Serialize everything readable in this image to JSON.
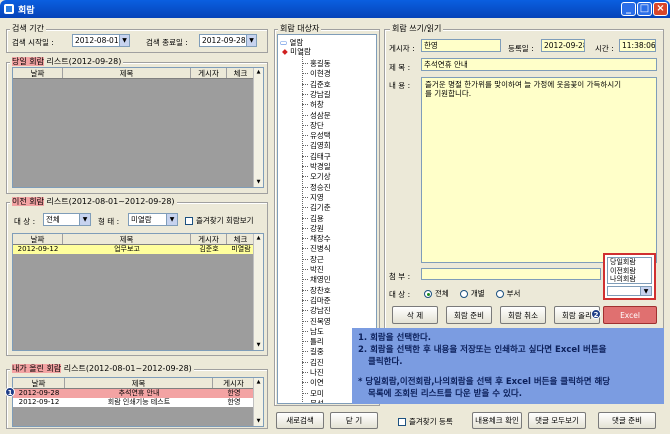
{
  "window": {
    "title": "회람"
  },
  "period": {
    "legend": "검색 기간",
    "start_label": "검색 시작일 :",
    "start_value": "2012-08-01",
    "end_label": "검색 종료일 :",
    "end_value": "2012-09-28"
  },
  "today": {
    "legend_hl": "당일 회람",
    "legend_rest": "리스트(2012-09-28)",
    "columns": [
      "날짜",
      "제목",
      "게시자",
      "체크"
    ]
  },
  "previous": {
    "legend_hl": "이전 회람",
    "legend_rest": "리스트(2012-08-01~2012-09-28)",
    "target_label": "대 상 :",
    "target_value": "전체",
    "type_label": "형 태 :",
    "type_value": "미열람",
    "fav_label": "즐겨찾기 회람보기",
    "columns": [
      "날짜",
      "제목",
      "게시자",
      "체크"
    ],
    "rows": [
      [
        "2012-09-12",
        "업무보고",
        "김준호",
        "미열람"
      ]
    ]
  },
  "mine": {
    "legend_hl": "내가 올린 회람",
    "legend_rest": "리스트(2012-08-01~2012-09-28)",
    "columns": [
      "날짜",
      "제목",
      "게시자"
    ],
    "rows": [
      [
        "2012-09-28",
        "추석연휴 안내",
        "한영"
      ],
      [
        "2012-09-12",
        "회람 인쇄기능 테스트",
        "한영"
      ]
    ]
  },
  "badges": {
    "one": "1",
    "two": "2"
  },
  "recipients": {
    "legend": "회람 대상자",
    "root1": "열람",
    "root2": "미열람",
    "names": [
      "홍길동",
      "이현경",
      "김준호",
      "강남길",
      "허창",
      "성삼문",
      "장단",
      "유성택",
      "김영희",
      "김태구",
      "박경일",
      "오기상",
      "정승진",
      "지영",
      "김기춘",
      "김용",
      "강원",
      "채장수",
      "진병식",
      "장근",
      "박진",
      "채영민",
      "장찬호",
      "김마준",
      "강남진",
      "진복영",
      "남도",
      "틀리",
      "길중",
      "김진",
      "나진",
      "이연",
      "모미",
      "문선"
    ]
  },
  "detail": {
    "legend": "회람 쓰기/읽기",
    "poster_label": "게시자 :",
    "poster": "한영",
    "date_label": "등록일 :",
    "date": "2012-09-28",
    "time_label": "시간 :",
    "time": "11:38:06",
    "title_label": "제  목 :",
    "title": "추석연휴 안내",
    "content_label": "내  용 :",
    "content": "즐거운 명절 한가위를 맞이하여 늘 가정에 웃음꽃이 가득하시기를 기원합니다.",
    "attach_label": "첨  부 :",
    "target_label": "대  상 :",
    "opt_all": "전체",
    "opt_individual": "개별",
    "opt_dept": "부서",
    "popup_items": [
      "당일회람",
      "이전회람",
      "나의회람"
    ]
  },
  "buttons": {
    "delete": "삭 제",
    "prepare": "회람 준비",
    "cancel": "회람 취소",
    "upload": "회람 올리",
    "excel": "Excel",
    "new_search": "새로검색",
    "close": "닫  기",
    "fav_register": "즐겨찾기 등록",
    "content_check": "내용체크 확인",
    "reply_all": "댓글 모두보기",
    "reply_prep": "댓글 준비"
  },
  "help": {
    "line1": "1. 회람을 선택한다.",
    "line2": "2. 회람을 선택한 후 내용을 저장또는 인쇄하고 싶다면 Excel 버튼을",
    "line2b": "클릭한다.",
    "line3": "* 당일회람,이전회람,나의회람을 선택 후 Excel 버든을 클릭하면 해당",
    "line3b": "목록에 조회된 리스트를 다운 받을 수 있다."
  },
  "colors": {
    "accent_red": "#f3a3a3",
    "help_bg": "#7b9ce1",
    "field_yellow": "#ffffc9",
    "excel_red": "#e07070"
  }
}
